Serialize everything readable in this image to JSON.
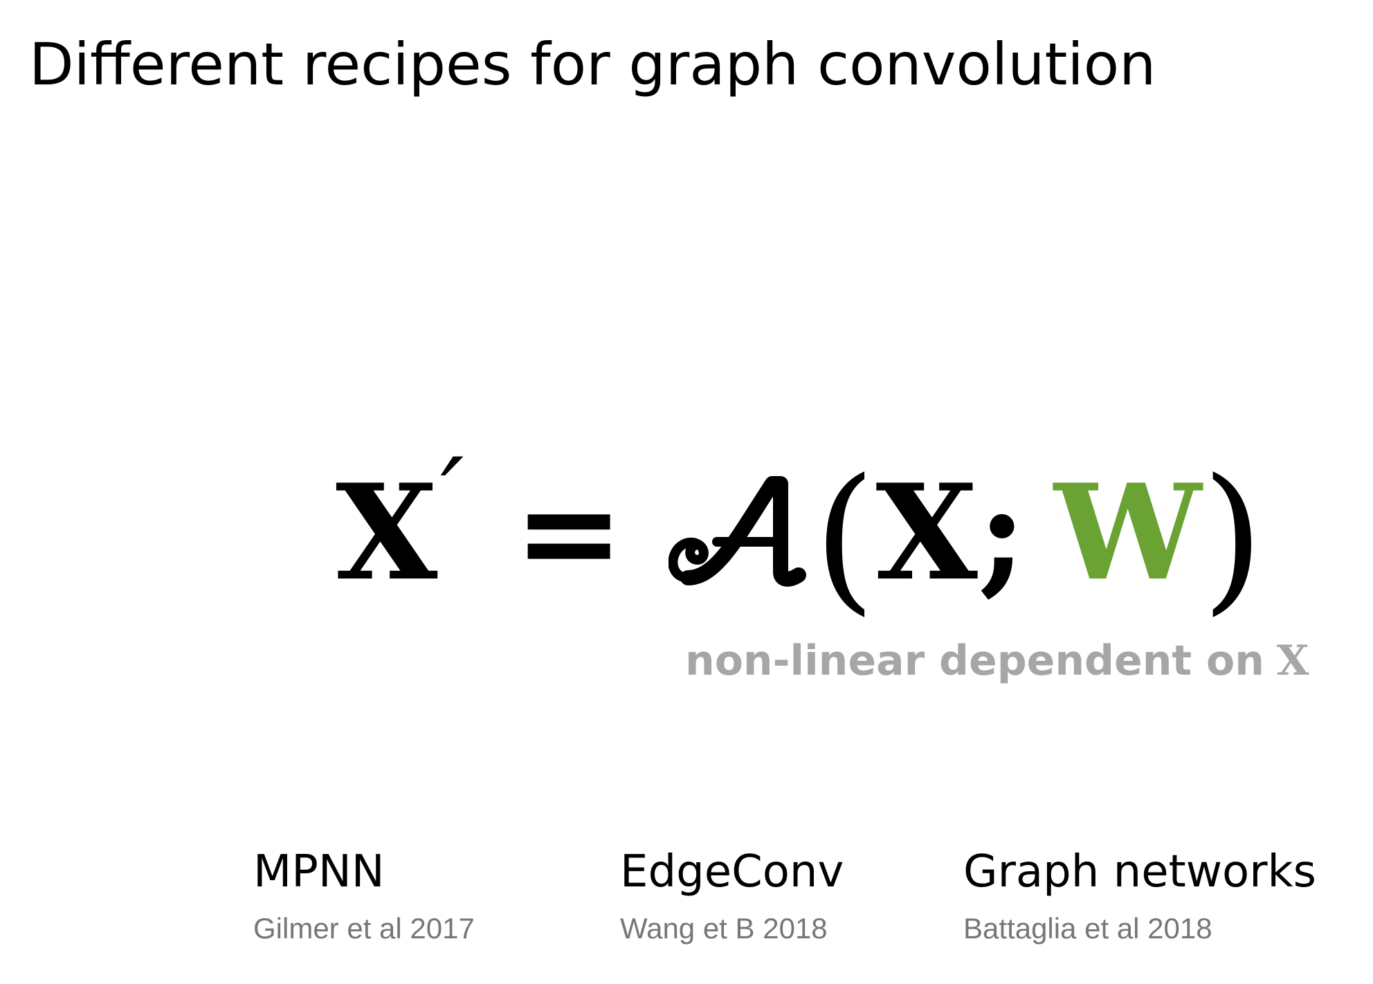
{
  "slide": {
    "title": "Different recipes for graph convolution"
  },
  "equation": {
    "lhs": "X",
    "prime": "′",
    "equals": "=",
    "function_symbol": "script-A",
    "open_paren": "(",
    "argument": "X",
    "separator": ";",
    "parameter": "W",
    "close_paren": ")",
    "parameter_color": "#6aa334"
  },
  "annotation": {
    "text": "non-linear dependent on",
    "symbol": "X",
    "color": "#a6a6a6"
  },
  "recipes": [
    {
      "name": "MPNN",
      "citation": "Gilmer et al 2017"
    },
    {
      "name": "EdgeConv",
      "citation": "Wang et B 2018"
    },
    {
      "name": "Graph networks",
      "citation": "Battaglia et al 2018"
    }
  ]
}
